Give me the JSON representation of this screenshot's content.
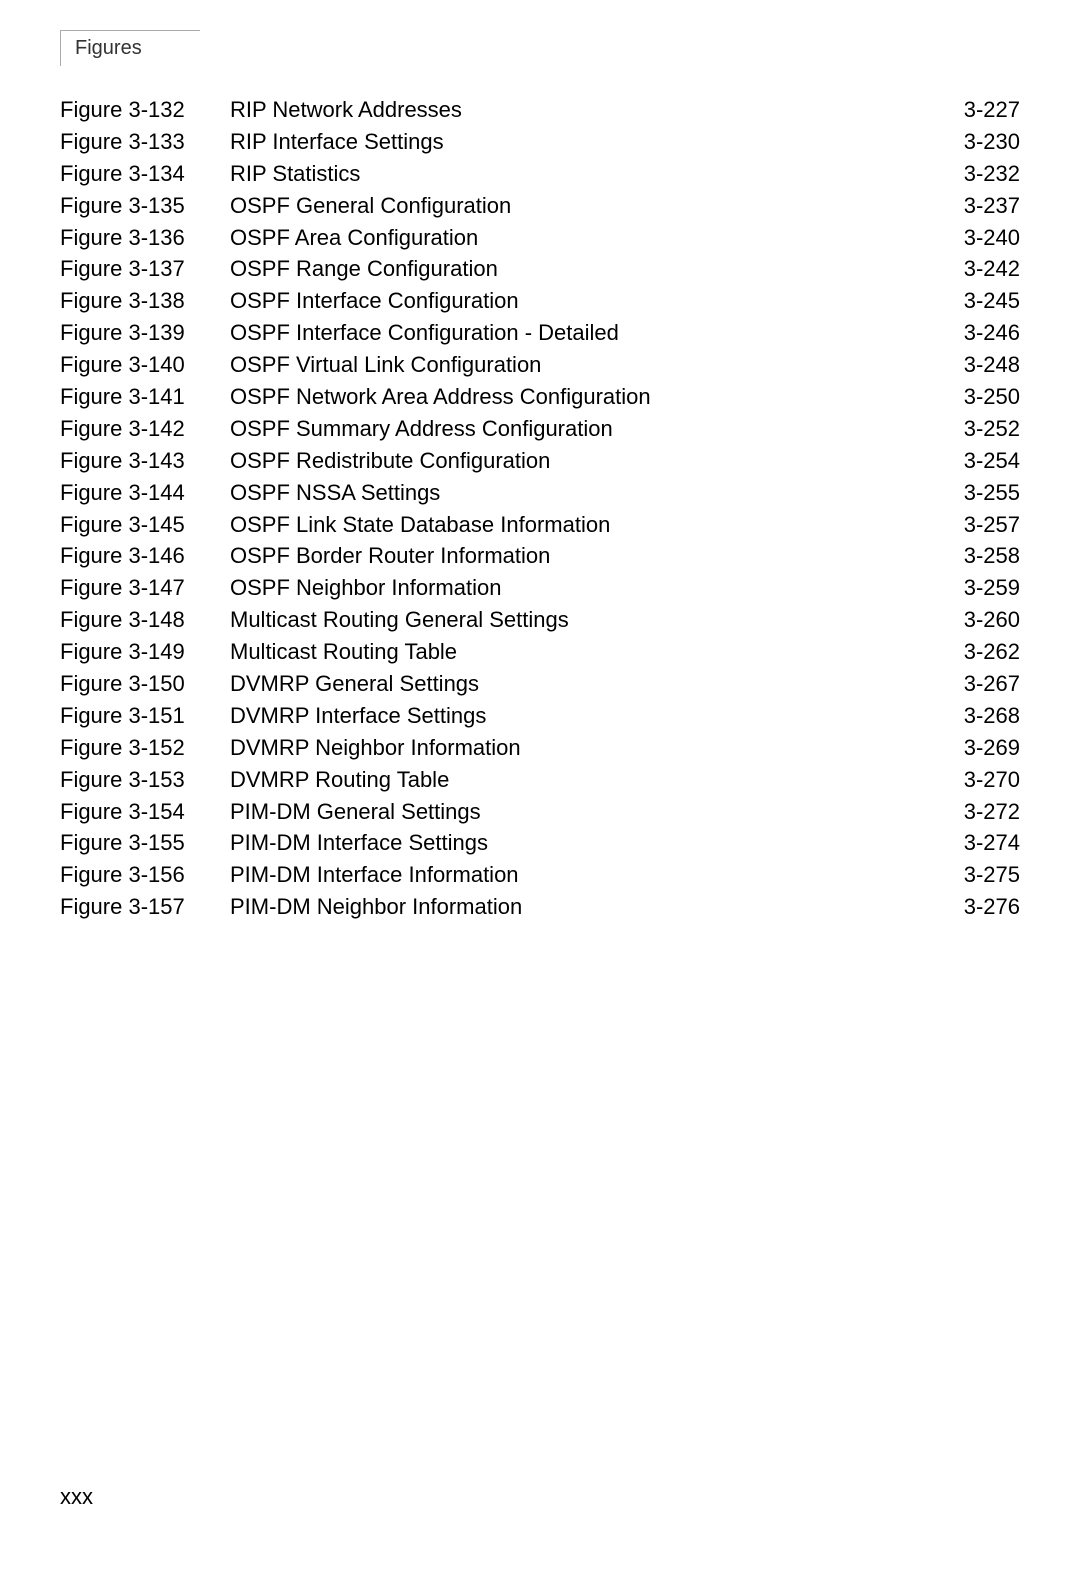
{
  "header": {
    "title": "Figures"
  },
  "figures": [
    {
      "id": "Figure 3-132",
      "title": "RIP Network Addresses",
      "page": "3-227"
    },
    {
      "id": "Figure 3-133",
      "title": "RIP Interface Settings",
      "page": "3-230"
    },
    {
      "id": "Figure 3-134",
      "title": "RIP Statistics",
      "page": "3-232"
    },
    {
      "id": "Figure 3-135",
      "title": "OSPF General Configuration",
      "page": "3-237"
    },
    {
      "id": "Figure 3-136",
      "title": "OSPF Area Configuration",
      "page": "3-240"
    },
    {
      "id": "Figure 3-137",
      "title": "OSPF Range Configuration",
      "page": "3-242"
    },
    {
      "id": "Figure 3-138",
      "title": "OSPF Interface Configuration",
      "page": "3-245"
    },
    {
      "id": "Figure 3-139",
      "title": "OSPF Interface Configuration - Detailed",
      "page": "3-246"
    },
    {
      "id": "Figure 3-140",
      "title": "OSPF Virtual Link Configuration",
      "page": "3-248"
    },
    {
      "id": "Figure 3-141",
      "title": "OSPF Network Area Address Configuration",
      "page": "3-250"
    },
    {
      "id": "Figure 3-142",
      "title": "OSPF Summary Address Configuration",
      "page": "3-252"
    },
    {
      "id": "Figure 3-143",
      "title": "OSPF Redistribute Configuration",
      "page": "3-254"
    },
    {
      "id": "Figure 3-144",
      "title": "OSPF NSSA Settings",
      "page": "3-255"
    },
    {
      "id": "Figure 3-145",
      "title": "OSPF Link State Database Information",
      "page": "3-257"
    },
    {
      "id": "Figure 3-146",
      "title": "OSPF Border Router Information",
      "page": "3-258"
    },
    {
      "id": "Figure 3-147",
      "title": "OSPF Neighbor Information",
      "page": "3-259"
    },
    {
      "id": "Figure 3-148",
      "title": "Multicast Routing General Settings",
      "page": "3-260"
    },
    {
      "id": "Figure 3-149",
      "title": "Multicast Routing Table",
      "page": "3-262"
    },
    {
      "id": "Figure 3-150",
      "title": "DVMRP General Settings",
      "page": "3-267"
    },
    {
      "id": "Figure 3-151",
      "title": "DVMRP Interface Settings",
      "page": "3-268"
    },
    {
      "id": "Figure 3-152",
      "title": "DVMRP Neighbor Information",
      "page": "3-269"
    },
    {
      "id": "Figure 3-153",
      "title": "DVMRP Routing Table",
      "page": "3-270"
    },
    {
      "id": "Figure 3-154",
      "title": "PIM-DM General Settings",
      "page": "3-272"
    },
    {
      "id": "Figure 3-155",
      "title": "PIM-DM Interface Settings",
      "page": "3-274"
    },
    {
      "id": "Figure 3-156",
      "title": "PIM-DM Interface Information",
      "page": "3-275"
    },
    {
      "id": "Figure 3-157",
      "title": "PIM-DM Neighbor Information",
      "page": "3-276"
    }
  ],
  "page_number": "xxx"
}
